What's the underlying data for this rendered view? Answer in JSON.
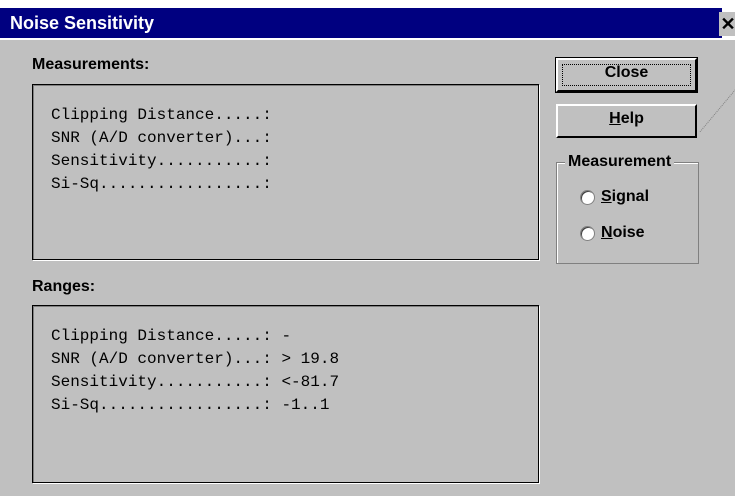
{
  "window": {
    "title": "Noise Sensitivity",
    "close_glyph": "✕"
  },
  "measurements": {
    "label": "Measurements:",
    "lines": [
      "Clipping Distance.....:",
      "SNR (A/D converter)...:",
      "Sensitivity...........:",
      "Si-Sq.................:"
    ]
  },
  "ranges": {
    "label": "Ranges:",
    "lines": [
      "Clipping Distance.....: -",
      "SNR (A/D converter)...: > 19.8",
      "Sensitivity...........: <-81.7",
      "Si-Sq.................: -1..1"
    ]
  },
  "buttons": {
    "close_label": "Close",
    "help_mnemonic": "H",
    "help_rest": "elp"
  },
  "measurement_group": {
    "legend": "Measurement",
    "signal_mnemonic": "S",
    "signal_rest": "ignal",
    "noise_mnemonic": "N",
    "noise_rest": "oise"
  },
  "colors": {
    "titlebar": "#000080",
    "face": "#c0c0c0"
  }
}
